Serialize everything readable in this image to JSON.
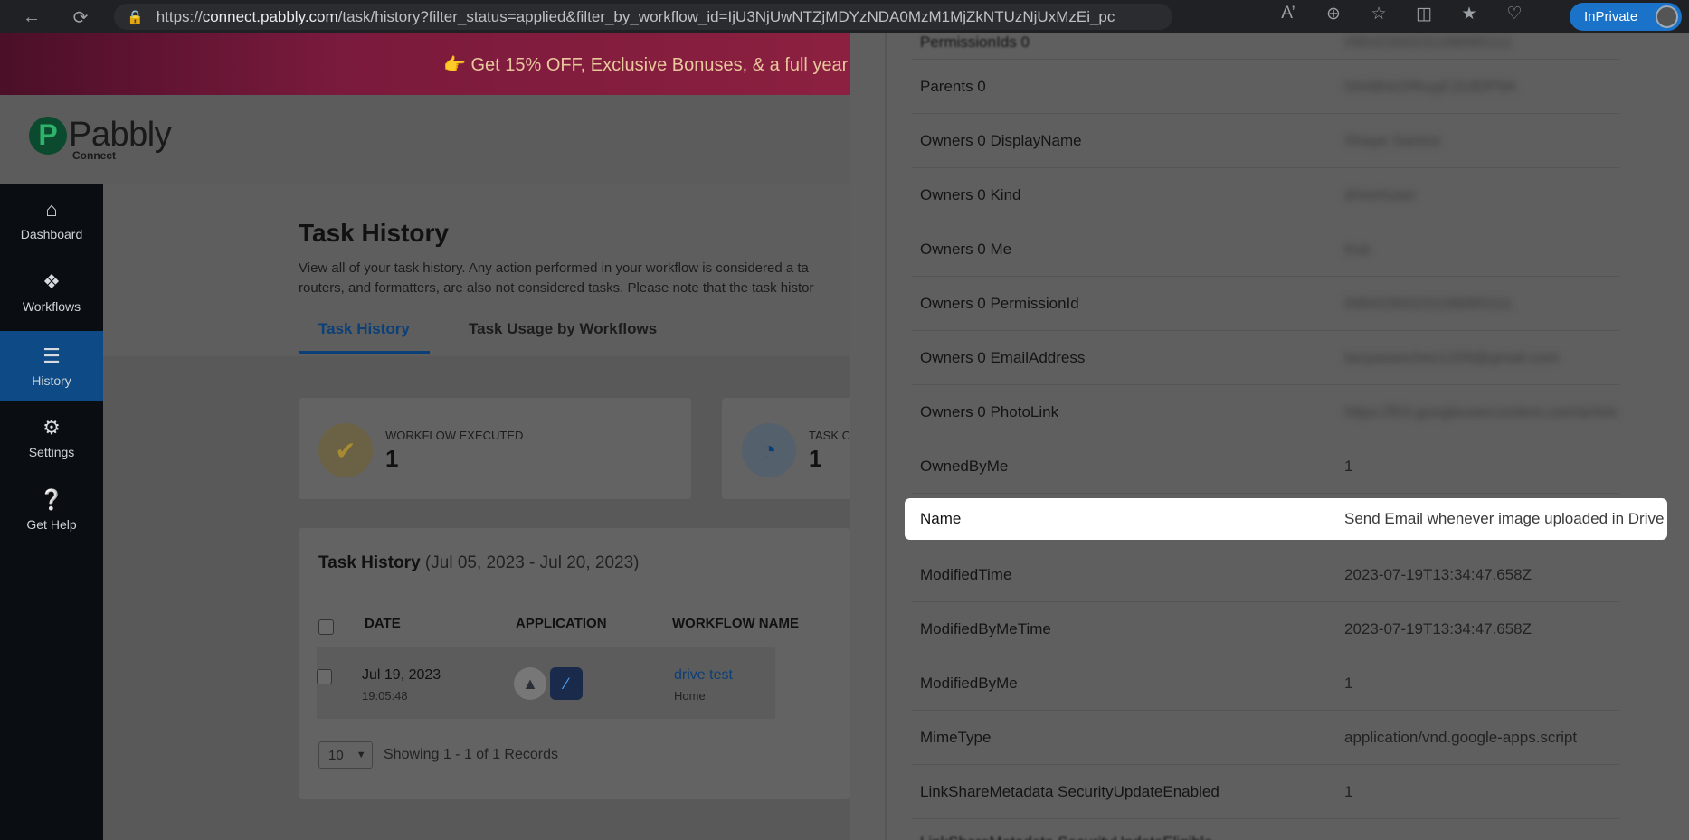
{
  "browser": {
    "url_prefix": "https://",
    "url_host": "connect.pabbly.com",
    "url_path": "/task/history?filter_status=applied&filter_by_workflow_id=IjU3NjUwNTZjMDYzNDA0MzM1MjZkNTUzNjUxMzEi_pc",
    "inprivate_label": "InPrivate"
  },
  "promo": {
    "text": "👉 Get 15% OFF, Exclusive Bonuses, & a full year"
  },
  "brand": {
    "logo_text": "Pabbly",
    "logo_sub": "Connect"
  },
  "sidebar": {
    "items": [
      {
        "label": "Dashboard",
        "icon": "home-icon"
      },
      {
        "label": "Workflows",
        "icon": "workflow-icon"
      },
      {
        "label": "History",
        "icon": "history-icon"
      },
      {
        "label": "Settings",
        "icon": "gear-icon"
      },
      {
        "label": "Get Help",
        "icon": "help-icon"
      }
    ]
  },
  "main": {
    "title": "Task History",
    "desc_line1": "View all of your task history. Any action performed in your workflow is considered a ta",
    "desc_line2": "routers, and formatters, are also not considered tasks. Please note that the task histor",
    "tabs": [
      "Task History",
      "Task Usage by Workflows"
    ],
    "stats": [
      {
        "label": "WORKFLOW EXECUTED",
        "value": "1"
      },
      {
        "label": "TASK C",
        "value": "1"
      }
    ],
    "table": {
      "title": "Task History",
      "range": "(Jul 05, 2023 - Jul 20, 2023)",
      "headers": [
        "DATE",
        "APPLICATION",
        "WORKFLOW NAME"
      ],
      "row": {
        "date": "Jul 19, 2023",
        "time": "19:05:48",
        "workflow": "drive test",
        "folder": "Home"
      },
      "page_size": "10",
      "showing": "Showing 1 - 1 of 1 Records"
    }
  },
  "drawer": {
    "rows": [
      {
        "key": "Parents 0",
        "value": "0AAB4cDRuyjC2UlDP9A",
        "blurred": true
      },
      {
        "key": "Owners 0 DisplayName",
        "value": "Shaye Santos",
        "blurred": true
      },
      {
        "key": "Owners 0 Kind",
        "value": "drive#user",
        "blurred": true
      },
      {
        "key": "Owners 0 Me",
        "value": "true",
        "blurred": true
      },
      {
        "key": "Owners 0 PermissionId",
        "value": "09542350231188065111",
        "blurred": true
      },
      {
        "key": "Owners 0 EmailAddress",
        "value": "tanyasanchez1209@gmail.com",
        "blurred": true
      },
      {
        "key": "Owners 0 PhotoLink",
        "value": "https://lh3.googleusercontent.com/a/AAcHTte",
        "blurred": true
      },
      {
        "key": "OwnedByMe",
        "value": "1",
        "blurred": false
      },
      {
        "key": "Name",
        "value": "Send Email whenever image uploaded in Drive",
        "blurred": false
      },
      {
        "key": "ModifiedTime",
        "value": "2023-07-19T13:34:47.658Z",
        "blurred": false
      },
      {
        "key": "ModifiedByMeTime",
        "value": "2023-07-19T13:34:47.658Z",
        "blurred": false
      },
      {
        "key": "ModifiedByMe",
        "value": "1",
        "blurred": false
      },
      {
        "key": "MimeType",
        "value": "application/vnd.google-apps.script",
        "blurred": false
      },
      {
        "key": "LinkShareMetadata SecurityUpdateEnabled",
        "value": "1",
        "blurred": false
      }
    ]
  }
}
